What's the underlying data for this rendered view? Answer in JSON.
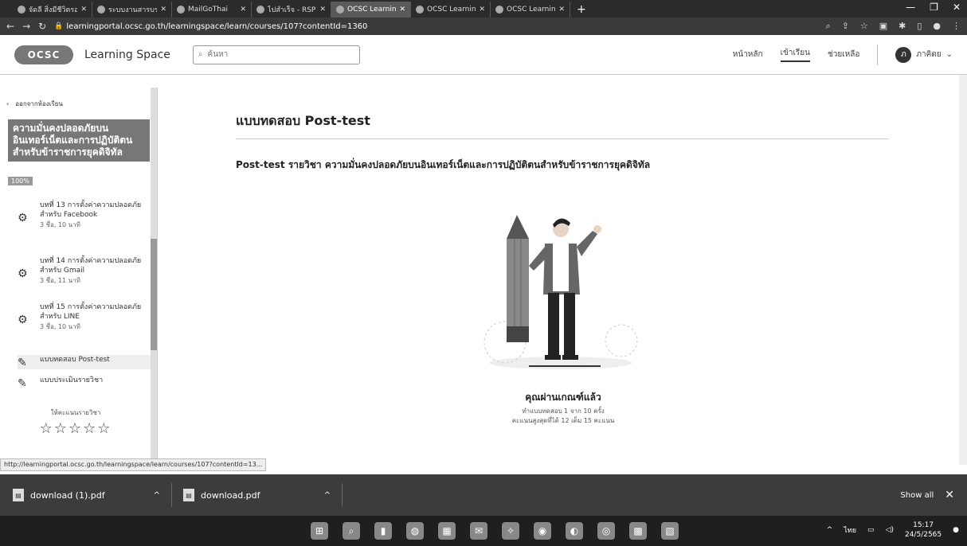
{
  "browser": {
    "tabs": [
      {
        "label": "จัดลี สิ่งมีชีวิตรอบตัว",
        "active": false
      },
      {
        "label": "ระบบงานสารบรรณ",
        "active": false
      },
      {
        "label": "MailGoThai",
        "active": false
      },
      {
        "label": "ไปสำเร็จ - RSPD",
        "active": false
      },
      {
        "label": "OCSC Learning Sp",
        "active": true
      },
      {
        "label": "OCSC Learning",
        "active": false
      },
      {
        "label": "OCSC Learning S",
        "active": false
      }
    ],
    "new_tab": "+",
    "url": "learningportal.ocsc.go.th/learningspace/learn/courses/107?contentId=1360"
  },
  "site": {
    "logo": "OCSC",
    "brand": "Learning Space",
    "search_placeholder": "ค้นหา",
    "nav": [
      {
        "label": "หน้าหลัก",
        "active": false
      },
      {
        "label": "เข้าเรียน",
        "active": true
      },
      {
        "label": "ช่วยเหลือ",
        "active": false
      }
    ],
    "user_name": "ภาคิตย",
    "user_initial": "ภ"
  },
  "sidebar": {
    "back_label": "ออกจากห้องเรียน",
    "course_title": "ความมั่นคงปลอดภัยบนอินเทอร์เน็ตและการปฏิบัติตนสำหรับข้าราชการยุคดิจิทัล",
    "progress": "100%",
    "lessons": [
      {
        "title": "บทที่ 13 การตั้งค่าความปลอดภัยสำหรับ Facebook",
        "meta": "3 ชื่อ, 10 นาที"
      },
      {
        "title": "บทที่ 14 การตั้งค่าความปลอดภัยสำหรับ Gmail",
        "meta": "3 ชื่อ, 11 นาที"
      },
      {
        "title": "บทที่ 15 การตั้งค่าความปลอดภัยสำหรับ LINE",
        "meta": "3 ชื่อ, 10 นาที"
      },
      {
        "title": "แบบทดสอบ Post-test",
        "meta": ""
      },
      {
        "title": "แบบประเมินรายวิชา",
        "meta": ""
      }
    ],
    "rating_label": "ให้คะแนนรายวิชา",
    "stars": "☆☆☆☆☆"
  },
  "main": {
    "title": "แบบทดสอบ Post-test",
    "description": "Post-test รายวิชา ความมั่นคงปลอดภัยบนอินเทอร์เน็ตและการปฏิบัติตนสำหรับข้าราชการยุคดิจิทัล",
    "result": "คุณผ่านเกณฑ์แล้ว",
    "result_attempts": "ทำแบบทดสอบ 1 จาก 10 ครั้ง",
    "result_score": "คะแนนสูงสุดที่ได้ 12 เต็ม 15 คะแนน"
  },
  "status_link": "http://learningportal.ocsc.go.th/learningspace/learn/courses/107?contentId=13...",
  "downloads": [
    {
      "name": "download (1).pdf"
    },
    {
      "name": "download.pdf"
    }
  ],
  "show_all": "Show all",
  "taskbar": {
    "lang": "ไทย",
    "time": "15:17",
    "date": "24/5/2565"
  },
  "colors": {
    "dark_chrome": "#2b2b2b",
    "logo_bg": "#777777"
  }
}
